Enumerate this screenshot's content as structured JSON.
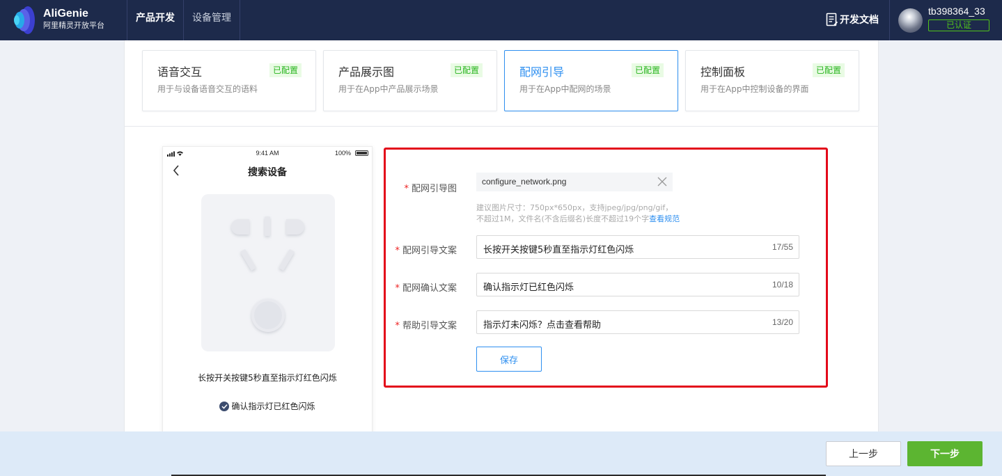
{
  "header": {
    "brand_en": "AliGenie",
    "brand_cn": "阿里精灵开放平台",
    "nav": [
      {
        "label": "产品开发",
        "active": true
      },
      {
        "label": "设备管理",
        "active": false
      }
    ],
    "docs_label": "开发文档",
    "username": "tb398364_33",
    "verified_badge": "已认证"
  },
  "cards": [
    {
      "title": "语音交互",
      "desc": "用于与设备语音交互的语料",
      "badge": "已配置",
      "active": false
    },
    {
      "title": "产品展示图",
      "desc": "用于在App中产品展示场景",
      "badge": "已配置",
      "active": false
    },
    {
      "title": "配网引导",
      "desc": "用于在App中配网的场景",
      "badge": "已配置",
      "active": true
    },
    {
      "title": "控制面板",
      "desc": "用于在App中控制设备的界面",
      "badge": "已配置",
      "active": false
    }
  ],
  "phone": {
    "time": "9:41 AM",
    "battery": "100%",
    "title": "搜索设备",
    "guide_text": "长按开关按键5秒直至指示灯红色闪烁",
    "confirm_text": "确认指示灯已红色闪烁"
  },
  "form": {
    "image_label": "配网引导图",
    "file_name": "configure_network.png",
    "hint_line1": "建议图片尺寸：750px*650px，支持jpeg/jpg/png/gif，",
    "hint_line2": "不超过1M，文件名(不含后缀名)长度不超过19个字",
    "hint_link": "查看规范",
    "fields": [
      {
        "label": "配网引导文案",
        "value": "长按开关按键5秒直至指示灯红色闪烁",
        "count": "17/55"
      },
      {
        "label": "配网确认文案",
        "value": "确认指示灯已红色闪烁",
        "count": "10/18"
      },
      {
        "label": "帮助引导文案",
        "value": "指示灯未闪烁？点击查看帮助",
        "count": "13/20"
      }
    ],
    "save_label": "保存"
  },
  "footer": {
    "prev_label": "上一步",
    "next_label": "下一步"
  },
  "colors": {
    "header_bg": "#1d2a4b",
    "accent": "#2e8ff0",
    "success": "#52c41a",
    "highlight_border": "#e3091a",
    "next_button": "#5cb531"
  }
}
